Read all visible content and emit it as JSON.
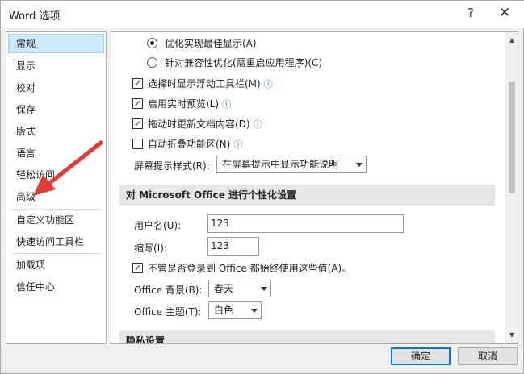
{
  "window": {
    "title": "Word 选项",
    "help": "?",
    "close": "✕"
  },
  "sidebar": {
    "items": [
      {
        "label": "常规"
      },
      {
        "label": "显示"
      },
      {
        "label": "校对"
      },
      {
        "label": "保存"
      },
      {
        "label": "版式"
      },
      {
        "label": "语言"
      },
      {
        "label": "轻松访问"
      },
      {
        "label": "高级"
      },
      {
        "label": "自定义功能区"
      },
      {
        "label": "快速访问工具栏"
      },
      {
        "label": "加载项"
      },
      {
        "label": "信任中心"
      }
    ],
    "selected": "常规"
  },
  "content": {
    "radio_optimize_best": "优化实现最佳显示(A)",
    "radio_optimize_compat": "针对兼容性优化(需重启应用程序)(C)",
    "check_minitoolbar": "选择时显示浮动工具栏(M)",
    "check_live_preview": "启用实时预览(L)",
    "check_update_drag": "拖动时更新文档内容(D)",
    "check_collapse_ribbon": "自动折叠功能区(N)",
    "screentip_label": "屏幕提示样式(R):",
    "screentip_value": "在屏幕提示中显示功能说明",
    "personalize_header": "对 Microsoft Office 进行个性化设置",
    "username_label": "用户名(U):",
    "username_value": "123",
    "initials_label": "缩写(I):",
    "initials_value": "123",
    "always_use_values": "不管是否登录到 Office 都始终使用这些值(A)。",
    "background_label": "Office 背景(B):",
    "background_value": "春天",
    "theme_label": "Office 主题(T):",
    "theme_value": "白色",
    "privacy_header": "隐私设置",
    "info_icon": "ⓘ"
  },
  "footer": {
    "ok": "确定",
    "cancel": "取消"
  },
  "colors": {
    "selected_bg": "#cde8ff",
    "accent": "#0078d7",
    "annotation_arrow": "#e53935"
  }
}
